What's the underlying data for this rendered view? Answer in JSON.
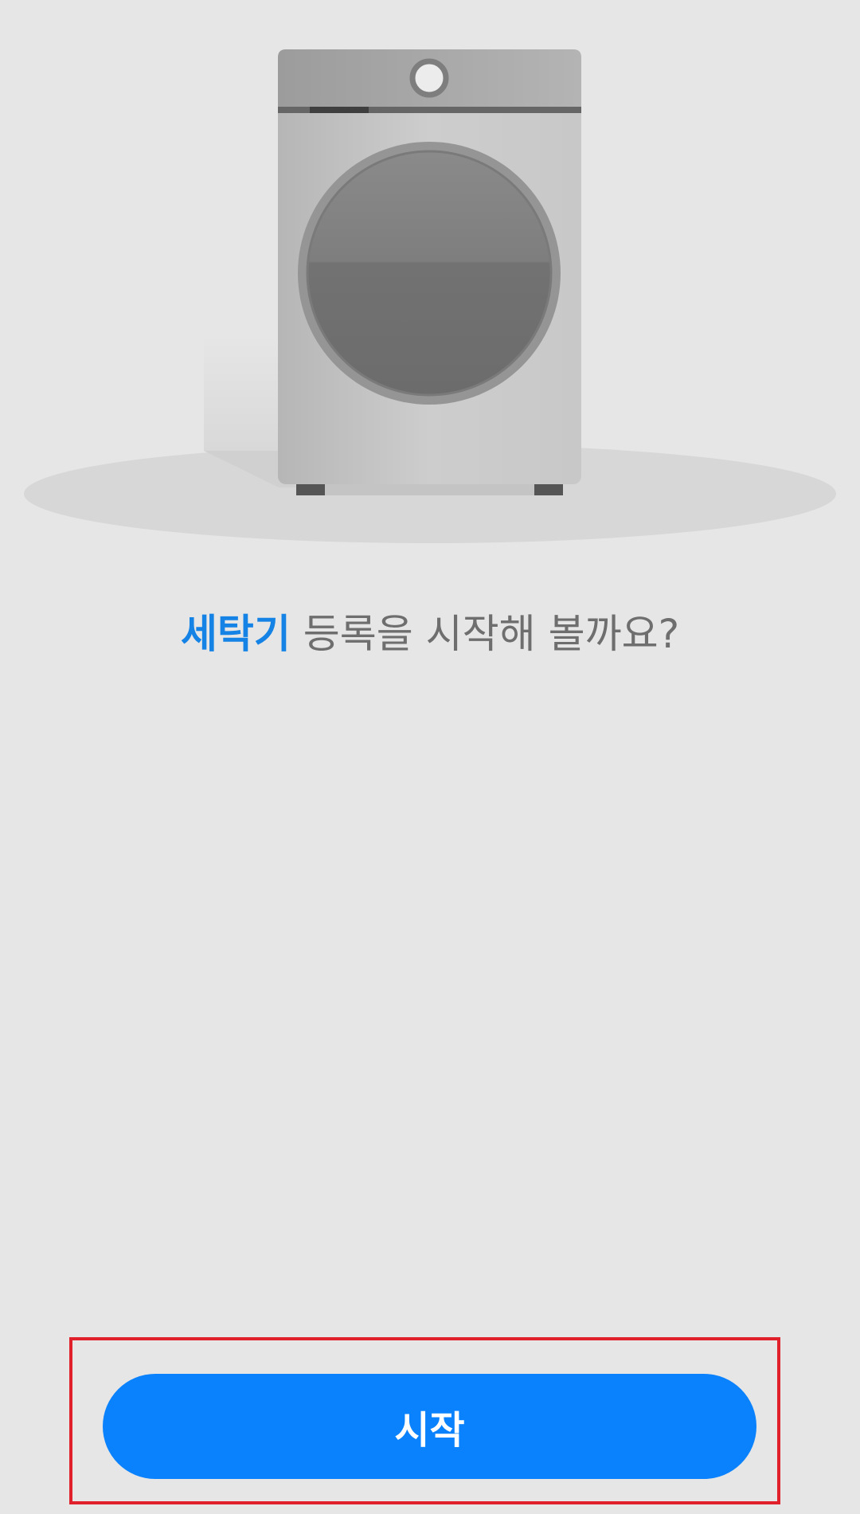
{
  "prompt": {
    "highlight": "세탁기",
    "rest": " 등록을 시작해 볼까요?",
    "highlight_color": "#1583e6",
    "text_color": "#6e6e6e"
  },
  "start_button": {
    "label": "시작",
    "color": "#0a82fd"
  },
  "illustration": {
    "icon": "washing-machine-icon"
  }
}
